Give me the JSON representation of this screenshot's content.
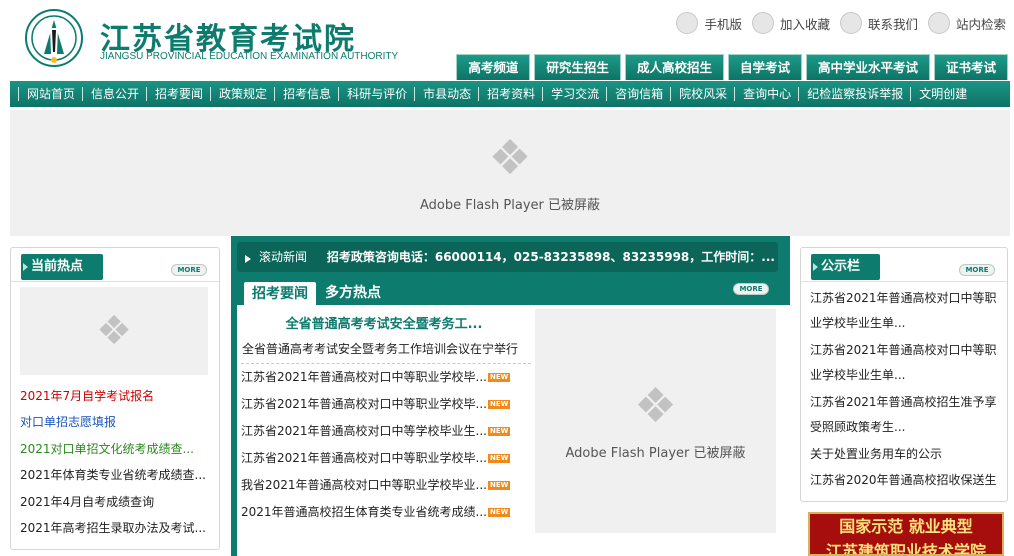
{
  "header": {
    "logo_cn": "江苏省教育考试院",
    "logo_en": "JIANGSU PROVINCIAL EDUCATION EXAMINATION AUTHORITY",
    "links": [
      {
        "label": "手机版",
        "icon": "mobile-icon"
      },
      {
        "label": "加入收藏",
        "icon": "bookmark-icon"
      },
      {
        "label": "联系我们",
        "icon": "contact-icon"
      },
      {
        "label": "站内检索",
        "icon": "search-icon"
      }
    ],
    "tabs": [
      "高考频道",
      "研究生招生",
      "成人高校招生",
      "自学考试",
      "高中学业水平考试",
      "证书考试"
    ]
  },
  "nav": [
    "网站首页",
    "信息公开",
    "招考要闻",
    "政策规定",
    "招考信息",
    "科研与评价",
    "市县动态",
    "招考资料",
    "学习交流",
    "咨询信箱",
    "院校风采",
    "查询中心",
    "纪检监察投诉举报",
    "文明创建"
  ],
  "flash_blocked_text": "Adobe Flash Player 已被屏蔽",
  "left_box": {
    "title": "当前热点",
    "more": "MORE",
    "items": [
      {
        "text": "2021年7月自学考试报名",
        "color": "#cc0000"
      },
      {
        "text": "对口单招志愿填报",
        "color": "#1a55b8"
      },
      {
        "text": "2021对口单招文化统考成绩查...",
        "color": "#2b8a1e"
      },
      {
        "text": "2021年体育类专业省统考成绩查...",
        "color": "#222222"
      },
      {
        "text": "2021年4月自考成绩查询",
        "color": "#222222"
      },
      {
        "text": "2021年高考招生录取办法及考试...",
        "color": "#222222"
      }
    ]
  },
  "ticker": {
    "label": "滚动新闻",
    "text": "招考政策咨询电话：66000114，025-83235898、83235998，工作时间：..."
  },
  "center": {
    "tabs": [
      "招考要闻",
      "多方热点"
    ],
    "more": "MORE",
    "headline": "全省普通高考考试安全暨考务工...",
    "headline_sub": "全省普通高考考试安全暨考务工作培训会议在宁举行",
    "new_badge": "NEW",
    "news": [
      "江苏省2021年普通高校对口中等职业学校毕...",
      "江苏省2021年普通高校对口中等职业学校毕...",
      "江苏省2021年普通高校对口中等学校毕业生...",
      "江苏省2021年普通高校对口中等职业学校毕...",
      "我省2021年普通高校对口中等职业学校毕业...",
      "2021年普通高校招生体育类专业省统考成绩..."
    ]
  },
  "right_box": {
    "title": "公示栏",
    "more": "MORE",
    "items": [
      "江苏省2021年普通高校对口中等职业学校毕业生单...",
      "江苏省2021年普通高校对口中等职业学校毕业生单...",
      "江苏省2021年普通高校招生准予享受照顾政策考生...",
      "关于处置业务用车的公示",
      "江苏省2020年普通高校招收保送生"
    ]
  },
  "banner": {
    "line1": "国家示范  就业典型",
    "line2": "江苏建筑职业技术学院"
  },
  "colors": {
    "primary": "#0d7c6e",
    "new_badge": "#f08a1a"
  }
}
